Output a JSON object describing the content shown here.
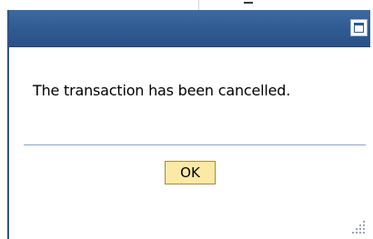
{
  "dialog": {
    "titlebar": {
      "maximize_icon": "maximize-icon",
      "color": "#2f5a91"
    },
    "message": "The transaction has been cancelled.",
    "ok_label": "OK",
    "ok_color": "#fde9a6",
    "resize_icon": "resize-grip-icon"
  }
}
